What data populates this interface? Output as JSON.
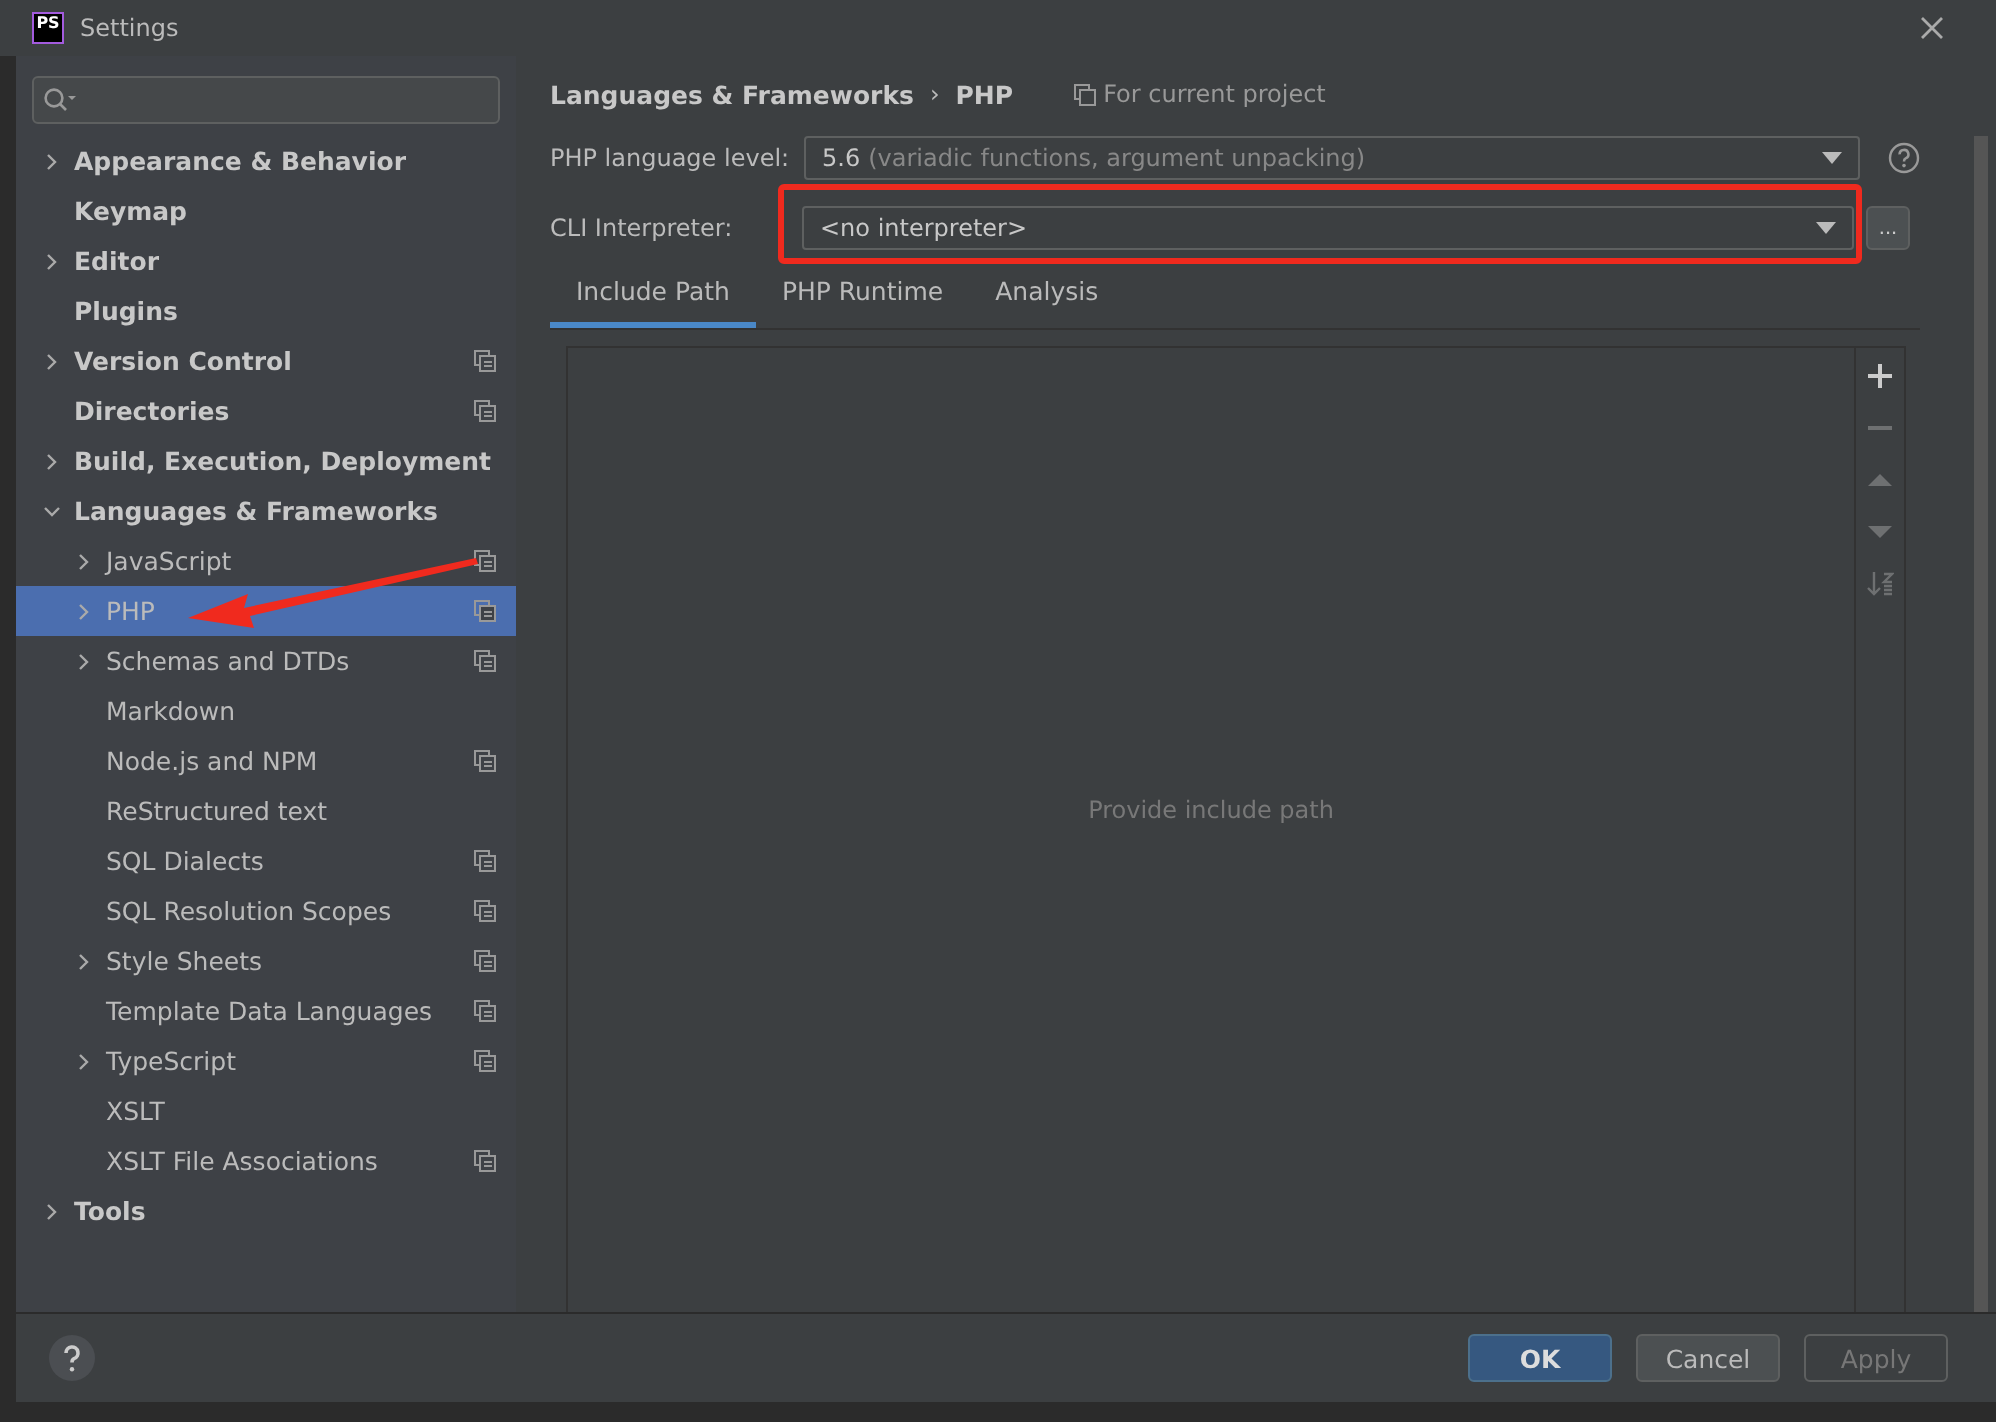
{
  "window": {
    "title": "Settings",
    "app_icon": "PS"
  },
  "sidebar": {
    "items": [
      {
        "label": "Appearance & Behavior",
        "expandable": true,
        "expanded": false,
        "selected": false,
        "project_scoped": false
      },
      {
        "label": "Keymap",
        "expandable": false,
        "expanded": false,
        "selected": false,
        "project_scoped": false
      },
      {
        "label": "Editor",
        "expandable": true,
        "expanded": false,
        "selected": false,
        "project_scoped": false
      },
      {
        "label": "Plugins",
        "expandable": false,
        "expanded": false,
        "selected": false,
        "project_scoped": false
      },
      {
        "label": "Version Control",
        "expandable": true,
        "expanded": false,
        "selected": false,
        "project_scoped": true
      },
      {
        "label": "Directories",
        "expandable": false,
        "expanded": false,
        "selected": false,
        "project_scoped": true
      },
      {
        "label": "Build, Execution, Deployment",
        "expandable": true,
        "expanded": false,
        "selected": false,
        "project_scoped": false
      },
      {
        "label": "Languages & Frameworks",
        "expandable": true,
        "expanded": true,
        "selected": false,
        "project_scoped": false,
        "children": [
          {
            "label": "JavaScript",
            "expandable": true,
            "expanded": false,
            "selected": false,
            "project_scoped": true
          },
          {
            "label": "PHP",
            "expandable": true,
            "expanded": false,
            "selected": true,
            "project_scoped": true
          },
          {
            "label": "Schemas and DTDs",
            "expandable": true,
            "expanded": false,
            "selected": false,
            "project_scoped": true
          },
          {
            "label": "Markdown",
            "expandable": false,
            "expanded": false,
            "selected": false,
            "project_scoped": false
          },
          {
            "label": "Node.js and NPM",
            "expandable": false,
            "expanded": false,
            "selected": false,
            "project_scoped": true
          },
          {
            "label": "ReStructured text",
            "expandable": false,
            "expanded": false,
            "selected": false,
            "project_scoped": false
          },
          {
            "label": "SQL Dialects",
            "expandable": false,
            "expanded": false,
            "selected": false,
            "project_scoped": true
          },
          {
            "label": "SQL Resolution Scopes",
            "expandable": false,
            "expanded": false,
            "selected": false,
            "project_scoped": true
          },
          {
            "label": "Style Sheets",
            "expandable": true,
            "expanded": false,
            "selected": false,
            "project_scoped": true
          },
          {
            "label": "Template Data Languages",
            "expandable": false,
            "expanded": false,
            "selected": false,
            "project_scoped": true
          },
          {
            "label": "TypeScript",
            "expandable": true,
            "expanded": false,
            "selected": false,
            "project_scoped": true
          },
          {
            "label": "XSLT",
            "expandable": false,
            "expanded": false,
            "selected": false,
            "project_scoped": false
          },
          {
            "label": "XSLT File Associations",
            "expandable": false,
            "expanded": false,
            "selected": false,
            "project_scoped": true
          }
        ]
      },
      {
        "label": "Tools",
        "expandable": true,
        "expanded": false,
        "selected": false,
        "project_scoped": false
      }
    ]
  },
  "breadcrumb": {
    "parent": "Languages & Frameworks",
    "separator": "›",
    "current": "PHP",
    "scope": "For current project"
  },
  "fields": [
    {
      "label": "PHP language level:",
      "value": "5.6",
      "hint": "(variadic functions, argument unpacking)",
      "help": true,
      "highlighted": false
    },
    {
      "label": "CLI Interpreter:",
      "value": "<no interpreter>",
      "help": false,
      "more_button": "...",
      "highlighted": true
    }
  ],
  "tabs": [
    {
      "label": "Include Path",
      "selected": true
    },
    {
      "label": "PHP Runtime",
      "selected": false
    },
    {
      "label": "Analysis",
      "selected": false
    }
  ],
  "include_path": {
    "empty_text": "Provide include path",
    "toolbar": [
      {
        "kind": "add",
        "disabled": false
      },
      {
        "kind": "remove",
        "disabled": true
      },
      {
        "kind": "up",
        "disabled": true
      },
      {
        "kind": "down",
        "disabled": true
      },
      {
        "kind": "sort",
        "disabled": true
      }
    ]
  },
  "buttons": [
    {
      "label": "OK",
      "kind": "default",
      "disabled": false
    },
    {
      "label": "Cancel",
      "kind": "normal",
      "disabled": false
    },
    {
      "label": "Apply",
      "kind": "normal",
      "disabled": true
    }
  ]
}
